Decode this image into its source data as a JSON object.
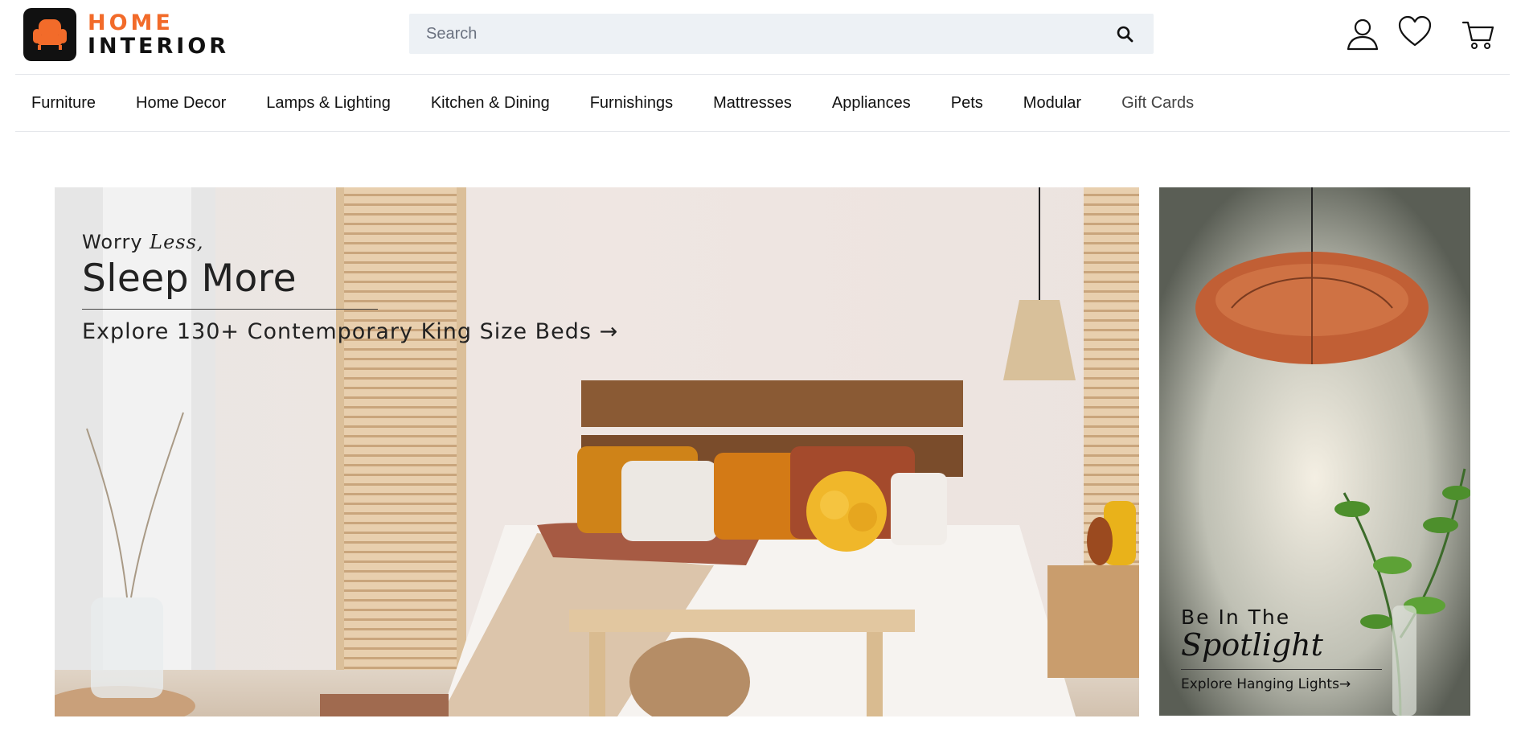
{
  "brand": {
    "line1": "HOME",
    "line2": "INTERIOR",
    "accent_color": "#f26b2a"
  },
  "search": {
    "placeholder": "Search",
    "icon": "search-icon"
  },
  "header_icons": [
    "user-icon",
    "heart-icon",
    "cart-icon"
  ],
  "nav": {
    "items": [
      {
        "label": "Furniture"
      },
      {
        "label": "Home Decor"
      },
      {
        "label": "Lamps & Lighting"
      },
      {
        "label": "Kitchen & Dining"
      },
      {
        "label": "Furnishings"
      },
      {
        "label": "Mattresses"
      },
      {
        "label": "Appliances"
      },
      {
        "label": "Pets"
      },
      {
        "label": "Modular"
      },
      {
        "label": "Gift Cards"
      }
    ]
  },
  "hero": {
    "pre_word": "Worry ",
    "pre_em": "Less,",
    "headline": "Sleep More",
    "cta": "Explore 130+ Contemporary King Size Beds",
    "arrow": "→"
  },
  "side": {
    "subtitle": "Be In The",
    "script": "Spotlight",
    "cta": "Explore Hanging Lights",
    "arrow": "→"
  }
}
